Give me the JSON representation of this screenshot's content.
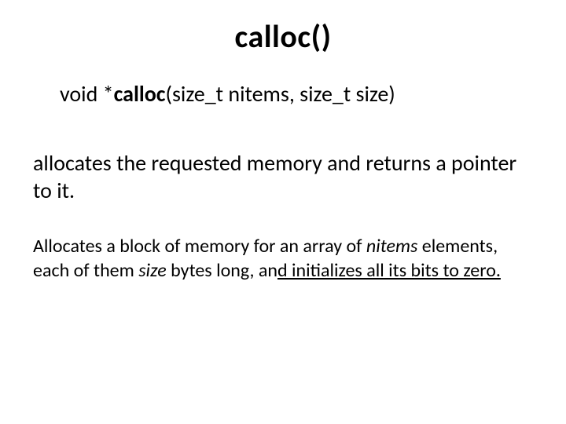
{
  "title": "calloc()",
  "signature": {
    "pre": "void *",
    "kw": "calloc",
    "post": "(size_t nitems, size_t size)"
  },
  "desc": "allocates the requested memory and returns a pointer to it.",
  "detail": {
    "p1": "Allocates a block of memory for an array of ",
    "nitems": "nitems",
    "p2": " elements, each of them ",
    "size": "size",
    "p3a": " bytes long, an",
    "p3u": "d initializes all its bits to zero."
  }
}
